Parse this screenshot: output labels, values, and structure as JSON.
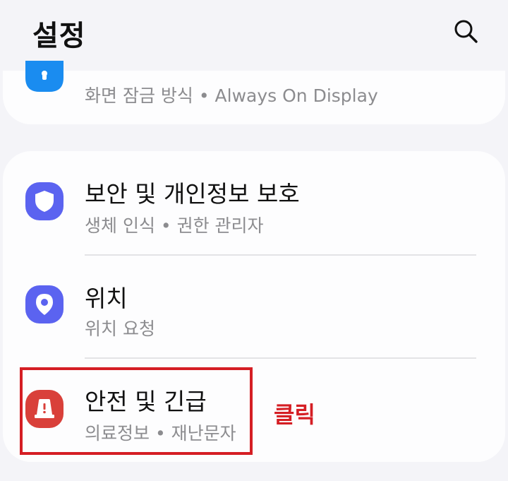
{
  "header": {
    "title": "설정"
  },
  "top_card": {
    "subtitle": "화면 잠금 방식 • Always On Display"
  },
  "items": [
    {
      "title": "보안 및 개인정보 보호",
      "subtitle": "생체 인식 • 권한 관리자"
    },
    {
      "title": "위치",
      "subtitle": "위치 요청"
    },
    {
      "title": "안전 및 긴급",
      "subtitle": "의료정보 • 재난문자"
    }
  ],
  "annotation": {
    "label": "클릭"
  },
  "colors": {
    "background": "#f4f4f8",
    "card": "#fdfdfe",
    "lock_icon": "#1a8cf0",
    "security_icon": "#5b63f0",
    "location_icon": "#5b63f0",
    "safety_icon": "#d9403a",
    "highlight": "#d51e24"
  }
}
